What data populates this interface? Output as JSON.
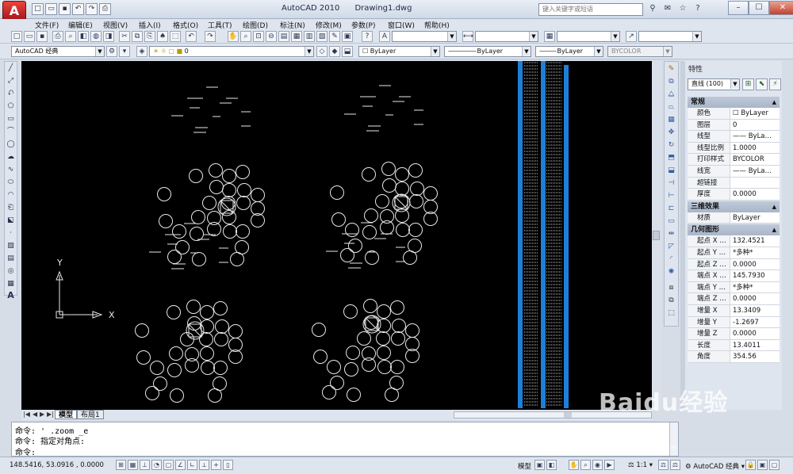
{
  "titlebar": {
    "app_logo": "A",
    "title": "AutoCAD 2010      Drawing1.dwg",
    "search_placeholder": "键入关键字或短语",
    "controls": [
      "–",
      "☐",
      "✕"
    ]
  },
  "menubar": {
    "items": [
      "文件(F)",
      "编辑(E)",
      "视图(V)",
      "插入(I)",
      "格式(O)",
      "工具(T)",
      "绘图(D)",
      "标注(N)",
      "修改(M)",
      "参数(P)",
      "窗口(W)",
      "帮助(H)"
    ]
  },
  "toolbar": {
    "workspace": "AutoCAD 经典",
    "layer": "0",
    "color": "ByLayer",
    "linetype": "ByLayer",
    "lineweight": "ByLayer",
    "plotstyle": "BYCOLOR"
  },
  "properties": {
    "title": "特性",
    "selection": "直线 (100)",
    "sections": [
      {
        "name": "常规",
        "rows": [
          [
            "颜色",
            "☐ ByLayer"
          ],
          [
            "图层",
            "0"
          ],
          [
            "线型",
            "—— ByLa…"
          ],
          [
            "线型比例",
            "1.0000"
          ],
          [
            "打印样式",
            "BYCOLOR"
          ],
          [
            "线宽",
            "—— ByLa…"
          ],
          [
            "超链接",
            ""
          ],
          [
            "厚度",
            "0.0000"
          ]
        ]
      },
      {
        "name": "三维效果",
        "rows": [
          [
            "材质",
            "ByLayer"
          ]
        ]
      },
      {
        "name": "几何图形",
        "rows": [
          [
            "起点 X …",
            "132.4521"
          ],
          [
            "起点 Y …",
            "*多种*"
          ],
          [
            "起点 Z …",
            "0.0000"
          ],
          [
            "端点 X …",
            "145.7930"
          ],
          [
            "端点 Y …",
            "*多种*"
          ],
          [
            "端点 Z …",
            "0.0000"
          ],
          [
            "增量 X",
            "13.3409"
          ],
          [
            "增量 Y",
            "-1.2697"
          ],
          [
            "增量 Z",
            "0.0000"
          ],
          [
            "长度",
            "13.4011"
          ],
          [
            "角度",
            "354.56"
          ]
        ]
      }
    ]
  },
  "canvas": {
    "ucs_x": "X",
    "ucs_y": "Y"
  },
  "tabs": {
    "model": "模型",
    "layout": "布局1"
  },
  "command": {
    "line1": "命令: ' .zoom _e",
    "line2": "命令: 指定对角点:",
    "line3": "命令:"
  },
  "status": {
    "coords": "148.5416, 53.0916 , 0.0000",
    "model": "模型",
    "scale": "1:1",
    "workspace": "AutoCAD 经典"
  },
  "watermark": {
    "main": "Baidu经验",
    "sub": "jingyan.baidu.com"
  }
}
